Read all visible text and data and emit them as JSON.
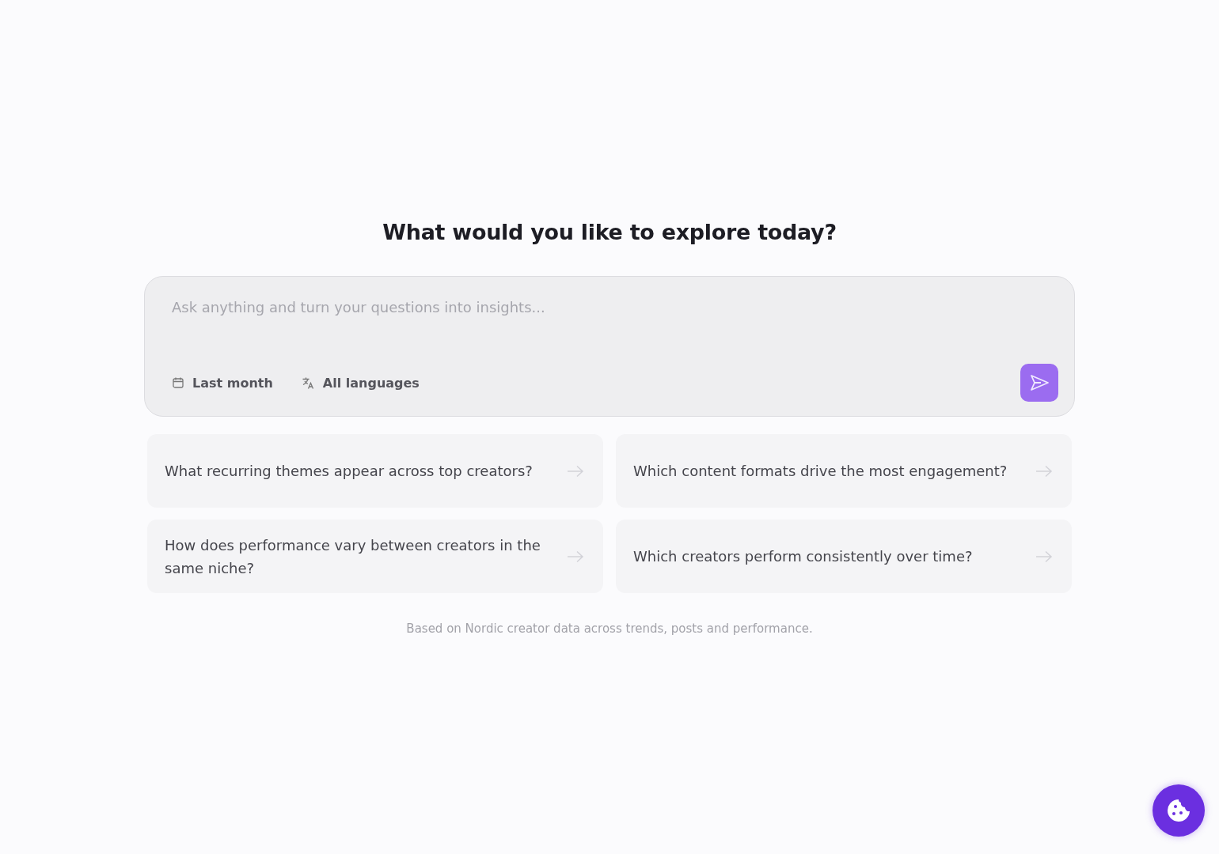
{
  "heading": "What would you like to explore today?",
  "prompt": {
    "placeholder": "Ask anything and turn your questions into insights...",
    "filters": [
      {
        "kind": "date",
        "label": "Last month"
      },
      {
        "kind": "language",
        "label": "All languages"
      }
    ]
  },
  "suggestions": [
    {
      "text": "What recurring themes appear across top creators?"
    },
    {
      "text": "Which content formats drive the most engagement?"
    },
    {
      "text": "How does performance vary between creators in the same niche?"
    },
    {
      "text": "Which creators perform consistently over time?"
    }
  ],
  "footnote": "Based on Nordic creator data across trends, posts and performance."
}
